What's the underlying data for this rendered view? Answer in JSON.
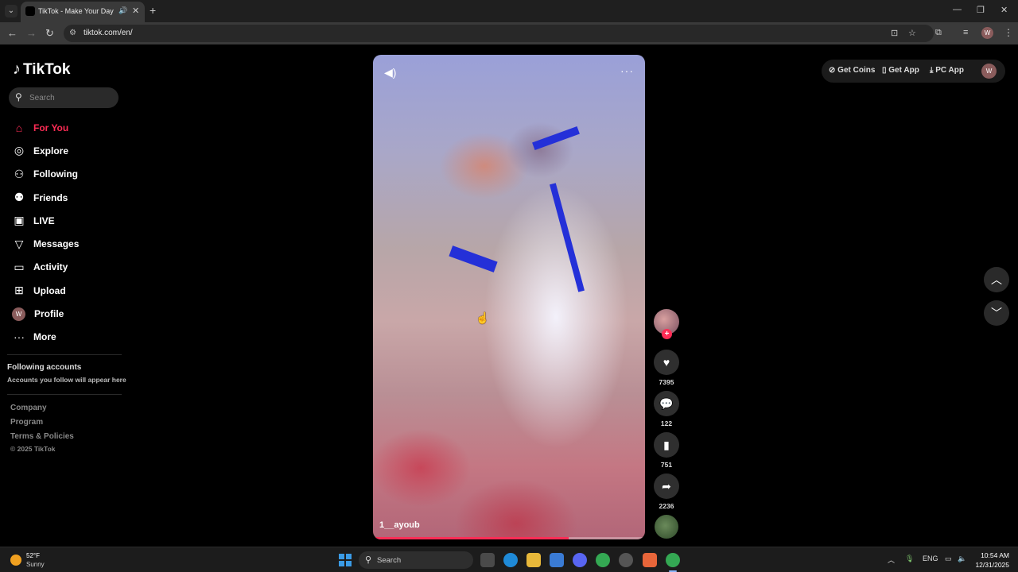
{
  "browser": {
    "tab_title": "TikTok - Make Your Day",
    "url": "tiktok.com/en/",
    "profile_initial": "W"
  },
  "tiktok": {
    "logo_text": "TikTok",
    "search_placeholder": "Search",
    "nav": [
      {
        "label": "For You",
        "icon": "home-icon",
        "active": true
      },
      {
        "label": "Explore",
        "icon": "compass-icon"
      },
      {
        "label": "Following",
        "icon": "following-icon"
      },
      {
        "label": "Friends",
        "icon": "friends-icon"
      },
      {
        "label": "LIVE",
        "icon": "live-icon"
      },
      {
        "label": "Messages",
        "icon": "messages-icon"
      },
      {
        "label": "Activity",
        "icon": "activity-icon"
      },
      {
        "label": "Upload",
        "icon": "upload-icon"
      },
      {
        "label": "Profile",
        "icon": "avatar",
        "initial": "W"
      },
      {
        "label": "More",
        "icon": "more-icon"
      }
    ],
    "following_title": "Following accounts",
    "following_sub": "Accounts you follow will appear here",
    "footer_links": [
      "Company",
      "Program",
      "Terms & Policies"
    ],
    "copyright": "© 2025 TikTok",
    "top_actions": {
      "get_coins": "Get Coins",
      "get_app": "Get App",
      "pc_app": "PC App",
      "avatar_initial": "W"
    },
    "video": {
      "author": "1__ayoub",
      "progress": 0.72
    },
    "actions": {
      "likes": "7395",
      "comments": "122",
      "saves": "751",
      "shares": "2236"
    }
  },
  "taskbar": {
    "weather_temp": "52°F",
    "weather_cond": "Sunny",
    "search_label": "Search",
    "lang": "ENG",
    "time": "10:54 AM",
    "date": "12/31/2025"
  },
  "colors": {
    "accent": "#fe2c55",
    "background": "#000000"
  }
}
